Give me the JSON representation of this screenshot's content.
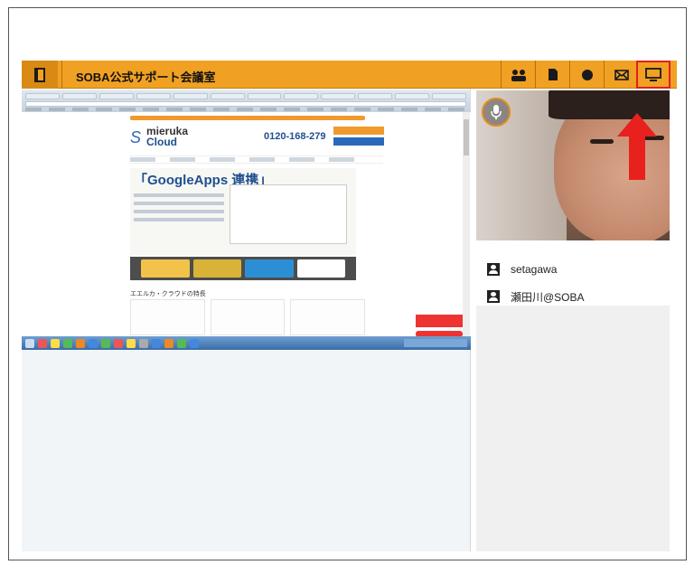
{
  "app": {
    "title": "SOBA公式サポート会議室"
  },
  "toolbar": {
    "items": [
      {
        "name": "participants-icon"
      },
      {
        "name": "document-icon"
      },
      {
        "name": "chat-icon"
      },
      {
        "name": "mail-icon"
      },
      {
        "name": "screen-share-icon",
        "highlighted": true
      }
    ]
  },
  "shared_screen": {
    "page_heading": "「GoogleApps 連携」",
    "brand_top": "mieruka",
    "brand_bottom": "Cloud",
    "phone": "0120-168-279",
    "section_title": "エエルカ・クラウドの特長"
  },
  "video": {
    "mic_icon": "microphone-icon"
  },
  "participants": [
    {
      "name": "setagawa"
    },
    {
      "name": "瀬田川@SOBA"
    }
  ],
  "colors": {
    "accent": "#f0a123",
    "highlight": "#e02020"
  }
}
